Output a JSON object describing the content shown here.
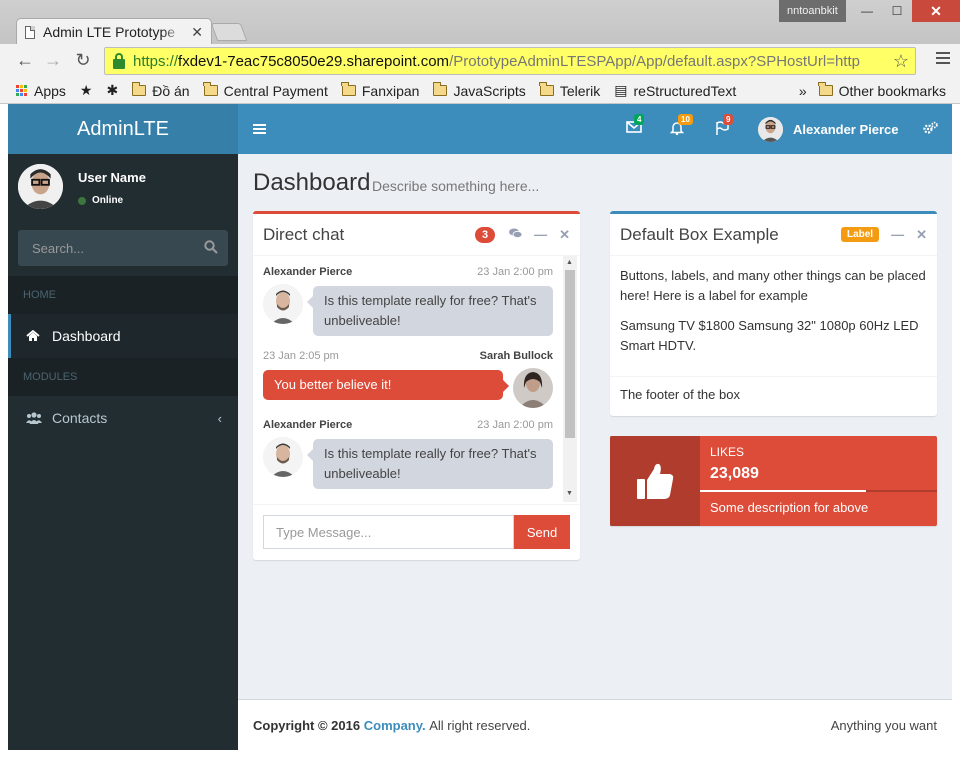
{
  "browser": {
    "tab_title": "Admin LTE Prototype",
    "tab_close": "✕",
    "profile": "nntoanbkit",
    "url": {
      "https": "https://",
      "host": "fxdev1-7eac75c8050e29.sharepoint.com",
      "path": "/PrototypeAdminLTESPApp/App/default.aspx?SPHostUrl=http"
    },
    "bookmarks": [
      "Đồ án",
      "Central Payment",
      "Fanxipan",
      "JavaScripts",
      "Telerik",
      "reStructuredText"
    ],
    "apps_label": "Apps",
    "more": "»",
    "other_bookmarks": "Other bookmarks"
  },
  "header": {
    "logo": "AdminLTE",
    "messages_count": "4",
    "notifications_count": "10",
    "tasks_count": "9",
    "user_name": "Alexander Pierce",
    "colors": {
      "messages": "#00a65a",
      "notifications": "#f39c12",
      "tasks": "#dd4b39"
    }
  },
  "sidebar": {
    "user_name": "User Name",
    "status": "Online",
    "search_placeholder": "Search...",
    "headers": [
      "HOME",
      "MODULES"
    ],
    "items": [
      {
        "label": "Dashboard",
        "icon": "home-icon"
      },
      {
        "label": "Contacts",
        "icon": "users-icon"
      }
    ]
  },
  "page": {
    "title": "Dashboard",
    "description": "Describe something here..."
  },
  "chat": {
    "title": "Direct chat",
    "badge": "3",
    "messages": [
      {
        "name": "Alexander Pierce",
        "time": "23 Jan 2:00 pm",
        "text": "Is this template really for free? That's unbeliveable!"
      },
      {
        "name": "Sarah Bullock",
        "time": "23 Jan 2:05 pm",
        "text": "You better believe it!"
      },
      {
        "name": "Alexander Pierce",
        "time": "23 Jan 2:00 pm",
        "text": "Is this template really for free? That's unbeliveable!"
      }
    ],
    "input_placeholder": "Type Message...",
    "send_label": "Send"
  },
  "default_box": {
    "title": "Default Box Example",
    "label": "Label",
    "paragraphs": [
      "Buttons, labels, and many other things can be placed here! Here is a label for example",
      "Samsung TV $1800 Samsung 32\" 1080p 60Hz LED Smart HDTV."
    ],
    "footer": "The footer of the box"
  },
  "info_box": {
    "text": "Likes",
    "number": "23,089",
    "progress": 0.7,
    "description": "Some description for above",
    "color": "#dd4b39"
  },
  "footer": {
    "copyright": "Copyright © 2016",
    "company": "Company.",
    "rights": "All right reserved.",
    "right_text": "Anything you want"
  }
}
